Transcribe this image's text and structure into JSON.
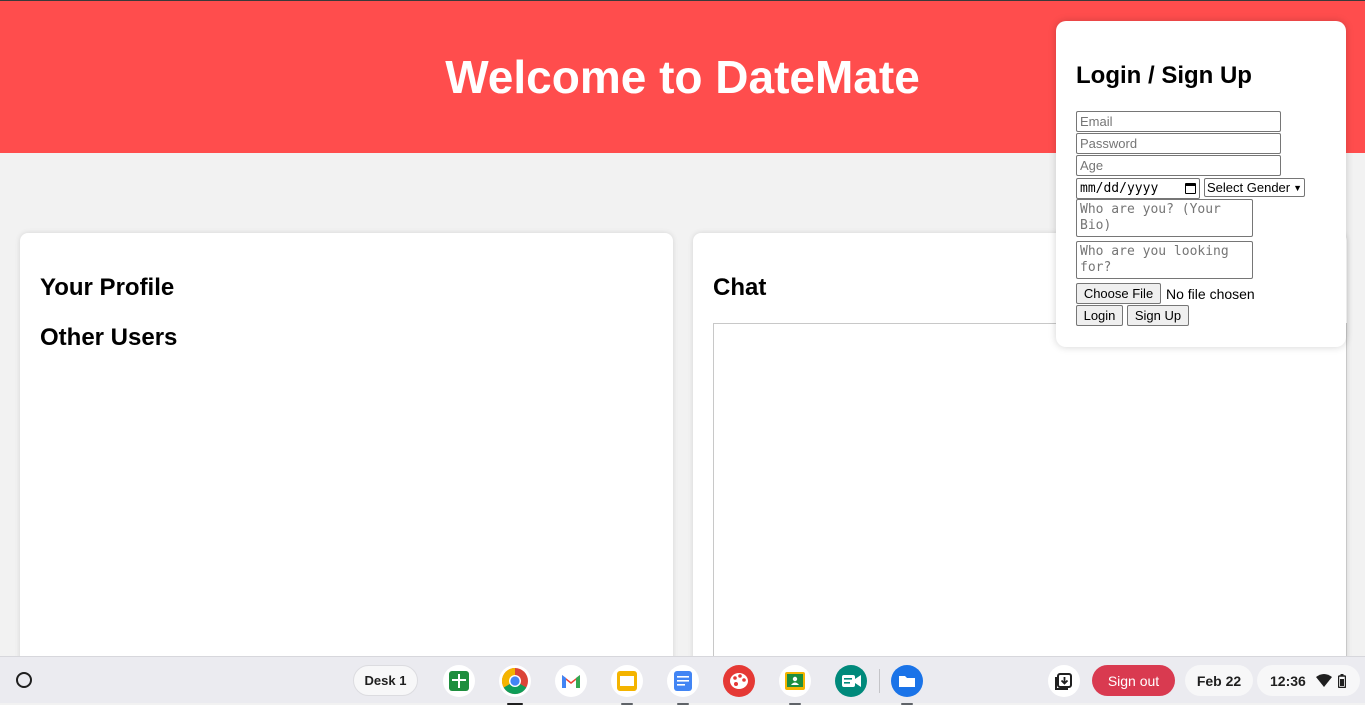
{
  "header": {
    "title": "Welcome to DateMate"
  },
  "profile": {
    "your_profile_heading": "Your Profile",
    "other_users_heading": "Other Users"
  },
  "chat": {
    "heading": "Chat"
  },
  "login": {
    "heading": "Login / Sign Up",
    "email_placeholder": "Email",
    "password_placeholder": "Password",
    "age_placeholder": "Age",
    "date_value": "mm/dd/yyyy",
    "gender_selected": "Select Gender",
    "bio_placeholder": "Who are you? (Your Bio)",
    "looking_for_placeholder": "Who are you looking for?",
    "choose_file_label": "Choose File",
    "file_status": "No file chosen",
    "login_label": "Login",
    "signup_label": "Sign Up"
  },
  "shelf": {
    "desk_label": "Desk 1",
    "apps": [
      "sheets-icon",
      "chrome-icon",
      "gmail-icon",
      "slides-icon",
      "docs-icon",
      "canvas-icon",
      "classroom-icon",
      "meet-icon",
      "files-icon"
    ],
    "sign_out_label": "Sign out",
    "date": "Feb 22",
    "time": "12:36"
  },
  "colors": {
    "brand": "#ff4d4d",
    "sign_out": "#d93a50"
  }
}
